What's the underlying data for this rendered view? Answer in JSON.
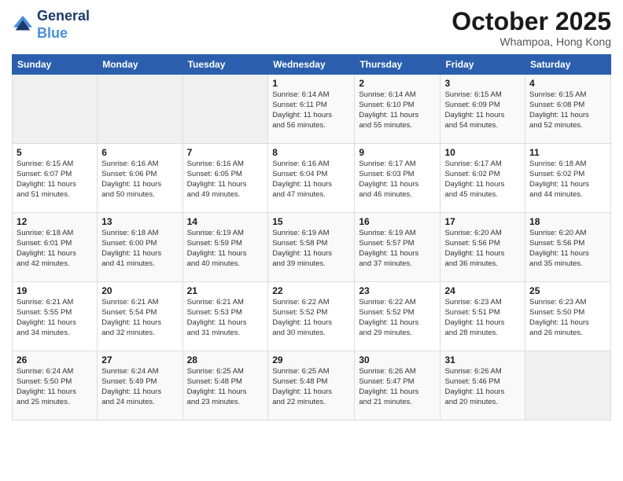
{
  "header": {
    "logo_line1": "General",
    "logo_line2": "Blue",
    "month": "October 2025",
    "location": "Whampoa, Hong Kong"
  },
  "weekdays": [
    "Sunday",
    "Monday",
    "Tuesday",
    "Wednesday",
    "Thursday",
    "Friday",
    "Saturday"
  ],
  "weeks": [
    [
      {
        "day": "",
        "info": ""
      },
      {
        "day": "",
        "info": ""
      },
      {
        "day": "",
        "info": ""
      },
      {
        "day": "1",
        "info": "Sunrise: 6:14 AM\nSunset: 6:11 PM\nDaylight: 11 hours\nand 56 minutes."
      },
      {
        "day": "2",
        "info": "Sunrise: 6:14 AM\nSunset: 6:10 PM\nDaylight: 11 hours\nand 55 minutes."
      },
      {
        "day": "3",
        "info": "Sunrise: 6:15 AM\nSunset: 6:09 PM\nDaylight: 11 hours\nand 54 minutes."
      },
      {
        "day": "4",
        "info": "Sunrise: 6:15 AM\nSunset: 6:08 PM\nDaylight: 11 hours\nand 52 minutes."
      }
    ],
    [
      {
        "day": "5",
        "info": "Sunrise: 6:15 AM\nSunset: 6:07 PM\nDaylight: 11 hours\nand 51 minutes."
      },
      {
        "day": "6",
        "info": "Sunrise: 6:16 AM\nSunset: 6:06 PM\nDaylight: 11 hours\nand 50 minutes."
      },
      {
        "day": "7",
        "info": "Sunrise: 6:16 AM\nSunset: 6:05 PM\nDaylight: 11 hours\nand 49 minutes."
      },
      {
        "day": "8",
        "info": "Sunrise: 6:16 AM\nSunset: 6:04 PM\nDaylight: 11 hours\nand 47 minutes."
      },
      {
        "day": "9",
        "info": "Sunrise: 6:17 AM\nSunset: 6:03 PM\nDaylight: 11 hours\nand 46 minutes."
      },
      {
        "day": "10",
        "info": "Sunrise: 6:17 AM\nSunset: 6:02 PM\nDaylight: 11 hours\nand 45 minutes."
      },
      {
        "day": "11",
        "info": "Sunrise: 6:18 AM\nSunset: 6:02 PM\nDaylight: 11 hours\nand 44 minutes."
      }
    ],
    [
      {
        "day": "12",
        "info": "Sunrise: 6:18 AM\nSunset: 6:01 PM\nDaylight: 11 hours\nand 42 minutes."
      },
      {
        "day": "13",
        "info": "Sunrise: 6:18 AM\nSunset: 6:00 PM\nDaylight: 11 hours\nand 41 minutes."
      },
      {
        "day": "14",
        "info": "Sunrise: 6:19 AM\nSunset: 5:59 PM\nDaylight: 11 hours\nand 40 minutes."
      },
      {
        "day": "15",
        "info": "Sunrise: 6:19 AM\nSunset: 5:58 PM\nDaylight: 11 hours\nand 39 minutes."
      },
      {
        "day": "16",
        "info": "Sunrise: 6:19 AM\nSunset: 5:57 PM\nDaylight: 11 hours\nand 37 minutes."
      },
      {
        "day": "17",
        "info": "Sunrise: 6:20 AM\nSunset: 5:56 PM\nDaylight: 11 hours\nand 36 minutes."
      },
      {
        "day": "18",
        "info": "Sunrise: 6:20 AM\nSunset: 5:56 PM\nDaylight: 11 hours\nand 35 minutes."
      }
    ],
    [
      {
        "day": "19",
        "info": "Sunrise: 6:21 AM\nSunset: 5:55 PM\nDaylight: 11 hours\nand 34 minutes."
      },
      {
        "day": "20",
        "info": "Sunrise: 6:21 AM\nSunset: 5:54 PM\nDaylight: 11 hours\nand 32 minutes."
      },
      {
        "day": "21",
        "info": "Sunrise: 6:21 AM\nSunset: 5:53 PM\nDaylight: 11 hours\nand 31 minutes."
      },
      {
        "day": "22",
        "info": "Sunrise: 6:22 AM\nSunset: 5:52 PM\nDaylight: 11 hours\nand 30 minutes."
      },
      {
        "day": "23",
        "info": "Sunrise: 6:22 AM\nSunset: 5:52 PM\nDaylight: 11 hours\nand 29 minutes."
      },
      {
        "day": "24",
        "info": "Sunrise: 6:23 AM\nSunset: 5:51 PM\nDaylight: 11 hours\nand 28 minutes."
      },
      {
        "day": "25",
        "info": "Sunrise: 6:23 AM\nSunset: 5:50 PM\nDaylight: 11 hours\nand 26 minutes."
      }
    ],
    [
      {
        "day": "26",
        "info": "Sunrise: 6:24 AM\nSunset: 5:50 PM\nDaylight: 11 hours\nand 25 minutes."
      },
      {
        "day": "27",
        "info": "Sunrise: 6:24 AM\nSunset: 5:49 PM\nDaylight: 11 hours\nand 24 minutes."
      },
      {
        "day": "28",
        "info": "Sunrise: 6:25 AM\nSunset: 5:48 PM\nDaylight: 11 hours\nand 23 minutes."
      },
      {
        "day": "29",
        "info": "Sunrise: 6:25 AM\nSunset: 5:48 PM\nDaylight: 11 hours\nand 22 minutes."
      },
      {
        "day": "30",
        "info": "Sunrise: 6:26 AM\nSunset: 5:47 PM\nDaylight: 11 hours\nand 21 minutes."
      },
      {
        "day": "31",
        "info": "Sunrise: 6:26 AM\nSunset: 5:46 PM\nDaylight: 11 hours\nand 20 minutes."
      },
      {
        "day": "",
        "info": ""
      }
    ]
  ]
}
